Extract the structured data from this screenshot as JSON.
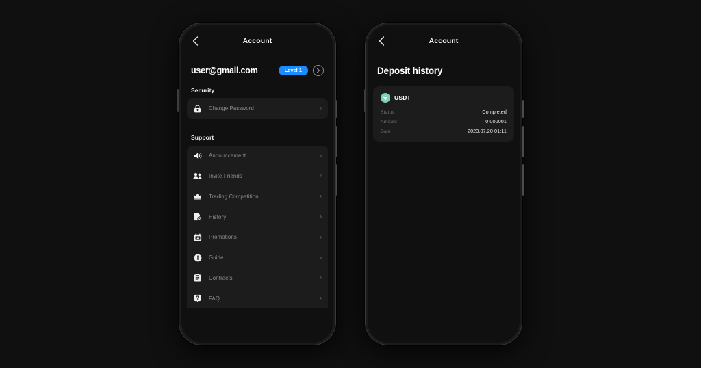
{
  "theme": {
    "background": "#101010",
    "card": "#1c1c1c",
    "accent_blue": "#1a8cff",
    "usdt_green": "#7fd1b0",
    "muted_text": "#8d8d8d"
  },
  "phone_left": {
    "appbar": {
      "back_icon": "chevron-left-icon",
      "title": "Account"
    },
    "account": {
      "email": "user@gmail.com",
      "level_badge": "Level 1",
      "detail_icon": "chevron-right-circle-icon"
    },
    "security": {
      "heading": "Security",
      "items": [
        {
          "label": "Change Password",
          "icon": "lock-icon"
        }
      ]
    },
    "support": {
      "heading": "Support",
      "items": [
        {
          "label": "Announcement",
          "icon": "speaker-icon"
        },
        {
          "label": "Invite Friends",
          "icon": "people-icon"
        },
        {
          "label": "Trading Competition",
          "icon": "crown-icon"
        },
        {
          "label": "History",
          "icon": "history-document-icon"
        },
        {
          "label": "Promotions",
          "icon": "ticket-calendar-icon"
        },
        {
          "label": "Guide",
          "icon": "info-circle-icon"
        },
        {
          "label": "Contracts",
          "icon": "clipboard-icon"
        },
        {
          "label": "FAQ",
          "icon": "question-box-icon"
        }
      ]
    }
  },
  "phone_right": {
    "appbar": {
      "back_icon": "chevron-left-icon",
      "title": "Account"
    },
    "page_title": "Deposit history",
    "deposits": [
      {
        "coin": "USDT",
        "coin_icon": "usdt-tether-icon",
        "rows": [
          {
            "key": "Status",
            "value": "Completed"
          },
          {
            "key": "Amount",
            "value": "0.000001"
          },
          {
            "key": "Date",
            "value": "2023.07.20 01:11"
          }
        ]
      }
    ]
  }
}
